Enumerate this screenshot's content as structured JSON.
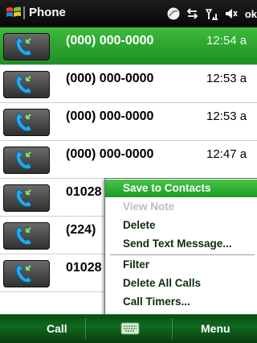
{
  "titlebar": {
    "app_title": "Phone",
    "ok_label": "ok",
    "tray_icons": [
      "connectivity-icon",
      "signal-icon",
      "speaker-icon"
    ]
  },
  "calls": [
    {
      "number": "(000) 000-0000",
      "time": "12:54 a",
      "selected": true
    },
    {
      "number": "(000) 000-0000",
      "time": "12:53 a",
      "selected": false
    },
    {
      "number": "(000) 000-0000",
      "time": "12:53 a",
      "selected": false
    },
    {
      "number": "(000) 000-0000",
      "time": "12:47 a",
      "selected": false
    },
    {
      "number": "01028",
      "time": "",
      "selected": false
    },
    {
      "number": "(224)",
      "time": "",
      "selected": false
    },
    {
      "number": "01028",
      "time": "",
      "selected": false
    }
  ],
  "context_menu": {
    "items": [
      {
        "label": "Save to Contacts",
        "highlighted": true,
        "disabled": false
      },
      {
        "label": "View Note",
        "highlighted": false,
        "disabled": true
      },
      {
        "label": "Delete",
        "highlighted": false,
        "disabled": false
      },
      {
        "label": "Send Text Message...",
        "highlighted": false,
        "disabled": false
      },
      {
        "label": "Filter",
        "highlighted": false,
        "disabled": false
      },
      {
        "label": "Delete All Calls",
        "highlighted": false,
        "disabled": false
      },
      {
        "label": "Call Timers...",
        "highlighted": false,
        "disabled": false
      }
    ]
  },
  "softkeys": {
    "left": "Call",
    "right": "Menu"
  },
  "colors": {
    "accent_green": "#1e8f24",
    "titlebar_black": "#070707",
    "softbar_green": "#0f6a1e"
  }
}
